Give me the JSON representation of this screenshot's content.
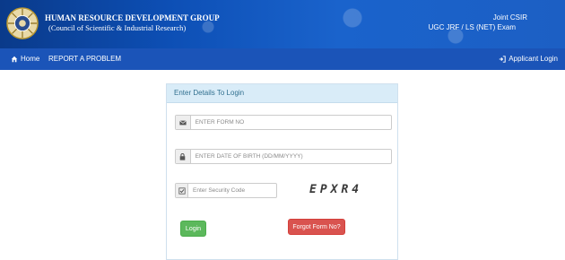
{
  "header": {
    "org_name": "HUMAN RESOURCE DEVELOPMENT GROUP",
    "org_sub": "(Council of Scientific & Industrial Research)",
    "exam_line1": "Joint CSIR",
    "exam_line2": "UGC JRF / LS (NET) Exam",
    "logo_icon": "csir-emblem-icon"
  },
  "navbar": {
    "home_label": "Home",
    "report_label": "REPORT A PROBLEM",
    "login_label": "Applicant Login",
    "home_icon": "home-icon",
    "login_icon": "sign-in-icon"
  },
  "login_panel": {
    "heading": "Enter Details To Login",
    "form_no": {
      "placeholder": "ENTER FORM NO",
      "value": "",
      "icon": "envelope-icon"
    },
    "dob": {
      "placeholder": "ENTER DATE OF BIRTH (DD/MM/YYYY)",
      "value": "",
      "icon": "lock-icon"
    },
    "security": {
      "placeholder": "Enter Security Code",
      "value": "",
      "icon": "checklist-icon"
    },
    "captcha_text": "EPXR4",
    "login_button": "Login",
    "forgot_button": "Forgot Form No?"
  },
  "colors": {
    "header_bg": "#0d4fb5",
    "navbar_bg": "#1b54b8",
    "panel_head_bg": "#d9ecf8",
    "login_btn": "#5cb85c",
    "forgot_btn": "#d9534f"
  }
}
